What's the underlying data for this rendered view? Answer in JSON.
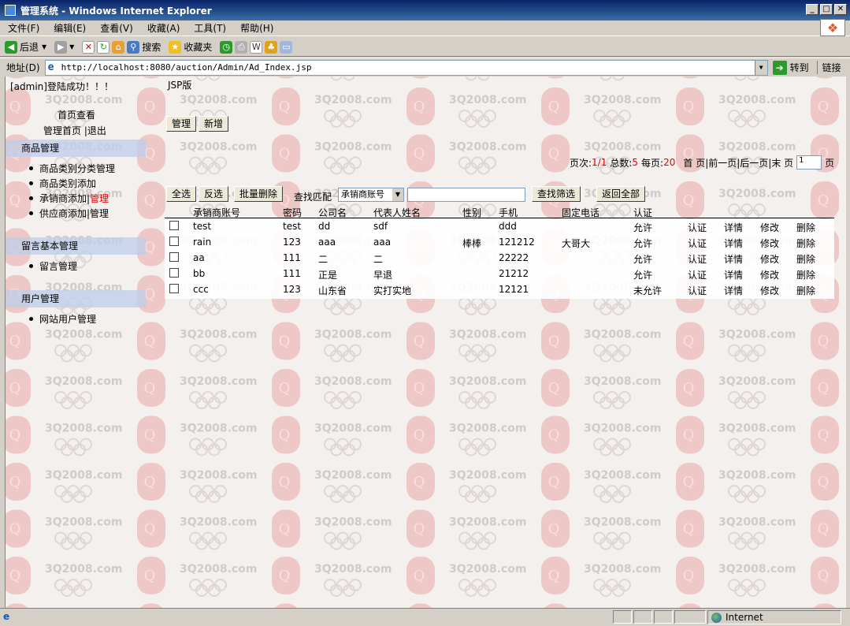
{
  "window": {
    "title": "管理系统 - Windows Internet Explorer",
    "controls": [
      "_",
      "□",
      "✕"
    ]
  },
  "menu": [
    "文件(F)",
    "编辑(E)",
    "查看(V)",
    "收藏(A)",
    "工具(T)",
    "帮助(H)"
  ],
  "toolbar": {
    "back": "后退",
    "search": "搜索",
    "favorites": "收藏夹"
  },
  "address": {
    "label": "地址(D)",
    "url": "http://localhost:8080/auction/Admin/Ad_Index.jsp",
    "go": "转到",
    "links": "链接"
  },
  "watermark": "3Q2008.com",
  "sidebar": {
    "login": "[admin]登陆成功！！！",
    "home_view": "首页查看",
    "admin_home": "管理首页",
    "logout": "|退出",
    "sections": [
      {
        "title": "商品管理"
      },
      {
        "title": "留言基本管理"
      },
      {
        "title": "用户管理"
      }
    ],
    "items": {
      "category_mgmt": "商品类别分类管理",
      "category_add": "商品类别添加",
      "distributor_add": "承销商添加|",
      "distributor_mgmt": "管理",
      "supplier_add": "供应商添加|管理",
      "message_mgmt": "留言管理",
      "site_user_mgmt": "网站用户管理"
    }
  },
  "main": {
    "jsp_label": "JSP版",
    "manage_button": "管理",
    "new_button": "新增",
    "pager": {
      "page_label": "页次:",
      "page_value": "1/1",
      "total_label": "总数:",
      "total_value": "5",
      "per_page_label": "每页:",
      "per_page_value": "20",
      "nav": "首 页|前一页|后一页|末 页",
      "page_input": "1",
      "page_suffix": "页"
    },
    "select_all": "全选",
    "invert": "反选",
    "batch_delete": "批量删除",
    "search_label": "查找匹配",
    "search_field_selected": "承销商账号",
    "search_button": "查找筛选",
    "return_all": "返回全部",
    "columns": [
      "承销商账号",
      "密码",
      "公司名",
      "代表人姓名",
      "性别",
      "手机",
      "固定电话",
      "认证"
    ],
    "rows": [
      {
        "account": "test",
        "password": "test",
        "company": "dd",
        "rep": "sdf",
        "gender": "",
        "mobile": "ddd",
        "phone": "",
        "cert": "允许"
      },
      {
        "account": "rain",
        "password": "123",
        "company": "aaa",
        "rep": "aaa",
        "gender": "棒棒",
        "mobile": "121212",
        "phone": "大哥大",
        "cert": "允许"
      },
      {
        "account": "aa",
        "password": "111",
        "company": "二",
        "rep": "二",
        "gender": "",
        "mobile": "22222",
        "phone": "",
        "cert": "允许"
      },
      {
        "account": "bb",
        "password": "111",
        "company": "正是",
        "rep": "早退",
        "gender": "",
        "mobile": "21212",
        "phone": "",
        "cert": "允许"
      },
      {
        "account": "ccc",
        "password": "123",
        "company": "山东省",
        "rep": "实打实地",
        "gender": "",
        "mobile": "12121",
        "phone": "",
        "cert": "未允许"
      }
    ],
    "row_actions": [
      "认证",
      "详情",
      "修改",
      "删除"
    ]
  },
  "status": {
    "zone": "Internet"
  },
  "colors": {
    "titlebar": "#0a246a",
    "highlight_red": "#e00000",
    "section_bg": "#bfcdeb"
  }
}
